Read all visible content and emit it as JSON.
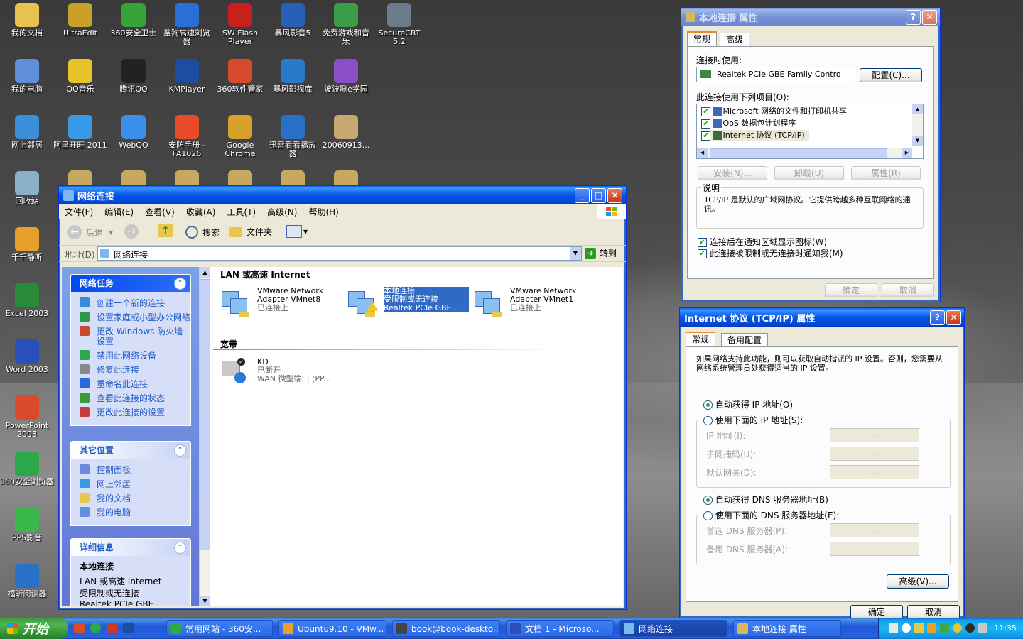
{
  "desktop_icons": [
    {
      "label": "我的文档",
      "color": "#e8c250"
    },
    {
      "label": "UltraEdit",
      "color": "#c9a12a"
    },
    {
      "label": "360安全卫士",
      "color": "#3aa23a"
    },
    {
      "label": "搜狗高速浏览器",
      "color": "#2b6fd6"
    },
    {
      "label": "SW Flash Player",
      "color": "#c8201c"
    },
    {
      "label": "暴风影音5",
      "color": "#2a5fb8"
    },
    {
      "label": "免费游戏和音乐",
      "color": "#3c9c4a"
    },
    {
      "label": "SecureCRT 5.2",
      "color": "#6b7b8b"
    },
    {
      "label": "我的电脑",
      "color": "#5e8fd8"
    },
    {
      "label": "QQ音乐",
      "color": "#e8c42a"
    },
    {
      "label": "腾讯QQ",
      "color": "#222"
    },
    {
      "label": "KMPlayer",
      "color": "#1c4da0"
    },
    {
      "label": "360软件管家",
      "color": "#d64b2b"
    },
    {
      "label": "暴风影视库",
      "color": "#2a78c8"
    },
    {
      "label": "波波唰e学园",
      "color": "#8a4fc8"
    },
    {
      "label": "网上邻居",
      "color": "#3a8fd8"
    },
    {
      "label": "阿里旺旺 2011",
      "color": "#3a9ae8"
    },
    {
      "label": "WebQQ",
      "color": "#3a8fe8"
    },
    {
      "label": "安防手册 -FA1026",
      "color": "#e84a2a"
    },
    {
      "label": "Google Chrome",
      "color": "#d8a22a"
    },
    {
      "label": "迅雷看看播放器",
      "color": "#2a6fc8"
    },
    {
      "label": "20060913...",
      "color": "#c8a870"
    },
    {
      "label": "回收站",
      "color": "#8ab0c8"
    },
    {
      "label": "千千静听",
      "color": "#e8a02a"
    },
    {
      "label": "Excel 2003",
      "color": "#2a8a3a"
    },
    {
      "label": "Word 2003",
      "color": "#2a4fb8"
    },
    {
      "label": "PowerPoint 2003",
      "color": "#d84a2a"
    },
    {
      "label": "360安全浏览器",
      "color": "#2aa84a"
    },
    {
      "label": "PPS影音",
      "color": "#3ab84a"
    },
    {
      "label": "福昕阅读器",
      "color": "#2a6fc8"
    }
  ],
  "netwin": {
    "title": "网络连接",
    "menu": [
      "文件(F)",
      "编辑(E)",
      "查看(V)",
      "收藏(A)",
      "工具(T)",
      "高级(N)",
      "帮助(H)"
    ],
    "toolbar": {
      "back": "后退",
      "search": "搜索",
      "folders": "文件夹"
    },
    "address_label": "地址(D)",
    "address_value": "网络连接",
    "go": "转到",
    "tasks_title": "网络任务",
    "tasks": [
      "创建一个新的连接",
      "设置家庭或小型办公网络",
      "更改 Windows 防火墙设置",
      "禁用此网络设备",
      "修复此连接",
      "重命名此连接",
      "查看此连接的状态",
      "更改此连接的设置"
    ],
    "other_title": "其它位置",
    "other": [
      "控制面板",
      "网上邻居",
      "我的文档",
      "我的电脑"
    ],
    "details_title": "详细信息",
    "details_name": "本地连接",
    "details_lines": [
      "LAN 或高速 Internet",
      "受限制或无连接",
      "Realtek PCIe GBE Family..."
    ],
    "group_lan": "LAN 或高速 Internet",
    "group_broadband": "宽带",
    "connections": [
      {
        "name": "VMware Network Adapter VMnet8",
        "status": "已连接上",
        "device": ""
      },
      {
        "name": "本地连接",
        "status": "受限制或无连接",
        "device": "Realtek PCIe GBE..."
      },
      {
        "name": "VMware Network Adapter VMnet1",
        "status": "已连接上",
        "device": ""
      }
    ],
    "broadband": {
      "name": "KD",
      "status": "已断开",
      "device": "WAN 微型端口 (PP..."
    }
  },
  "propwin": {
    "title": "本地连接 属性",
    "tabs": [
      "常规",
      "高级"
    ],
    "connect_using": "连接时使用:",
    "adapter": "Realtek PCIe GBE Family Contro",
    "config": "配置(C)...",
    "items_label": "此连接使用下列项目(O):",
    "items": [
      "Microsoft 网络的文件和打印机共享",
      "QoS 数据包计划程序",
      "Internet 协议 (TCP/IP)"
    ],
    "install": "安装(N)...",
    "uninstall": "卸载(U)",
    "properties": "属性(R)",
    "desc_label": "说明",
    "desc": "TCP/IP 是默认的广域网协议。它提供跨越多种互联网络的通讯。",
    "chk1": "连接后在通知区域显示图标(W)",
    "chk2": "此连接被限制或无连接时通知我(M)",
    "ok": "确定",
    "cancel": "取消"
  },
  "tcpwin": {
    "title": "Internet 协议 (TCP/IP) 属性",
    "tabs": [
      "常规",
      "备用配置"
    ],
    "intro": "如果网络支持此功能，则可以获取自动指派的 IP 设置。否则，您需要从网络系统管理员处获得适当的 IP 设置。",
    "auto_ip": "自动获得 IP 地址(O)",
    "manual_ip": "使用下面的 IP 地址(S):",
    "ip": "IP 地址(I):",
    "mask": "子网掩码(U):",
    "gateway": "默认网关(D):",
    "auto_dns": "自动获得 DNS 服务器地址(B)",
    "manual_dns": "使用下面的 DNS 服务器地址(E):",
    "dns1": "首选 DNS 服务器(P):",
    "dns2": "备用 DNS 服务器(A):",
    "ip_placeholder": ". . .",
    "advanced": "高级(V)...",
    "ok": "确定",
    "cancel": "取消"
  },
  "taskbar": {
    "start": "开始",
    "tasks": [
      "常用网站 - 360安...",
      "Ubuntu9.10 - VMw...",
      "book@book-deskto...",
      "文档 1 - Microso...",
      "网络连接",
      "本地连接 属性"
    ],
    "time": "11:35"
  },
  "colors": {
    "xp_blue": "#0453e6",
    "selection": "#316ac5",
    "link": "#215dc6"
  }
}
